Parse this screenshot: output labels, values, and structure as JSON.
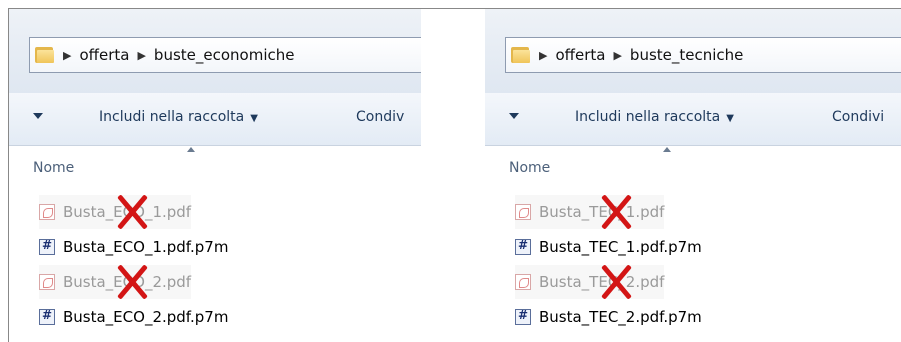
{
  "left_window": {
    "breadcrumb": [
      "offerta",
      "buste_economiche"
    ],
    "toolbar": {
      "include_label": "Includi nella raccolta",
      "share_label": "Condiv"
    },
    "column_header": "Nome",
    "files": [
      {
        "name": "Busta_ECO_1.pdf",
        "type": "pdf",
        "crossed": true
      },
      {
        "name": "Busta_ECO_1.pdf.p7m",
        "type": "p7m",
        "crossed": false
      },
      {
        "name": "Busta_ECO_2.pdf",
        "type": "pdf",
        "crossed": true
      },
      {
        "name": "Busta_ECO_2.pdf.p7m",
        "type": "p7m",
        "crossed": false
      }
    ]
  },
  "right_window": {
    "breadcrumb": [
      "offerta",
      "buste_tecniche"
    ],
    "toolbar": {
      "include_label": "Includi nella raccolta",
      "share_label": "Condivi"
    },
    "column_header": "Nome",
    "files": [
      {
        "name": "Busta_TEC_1.pdf",
        "type": "pdf",
        "crossed": true
      },
      {
        "name": "Busta_TEC_1.pdf.p7m",
        "type": "p7m",
        "crossed": false
      },
      {
        "name": "Busta_TEC_2.pdf",
        "type": "pdf",
        "crossed": true
      },
      {
        "name": "Busta_TEC_2.pdf.p7m",
        "type": "p7m",
        "crossed": false
      }
    ]
  },
  "colors": {
    "cross_mark": "#d31515",
    "toolbar_text": "#1e395b"
  }
}
